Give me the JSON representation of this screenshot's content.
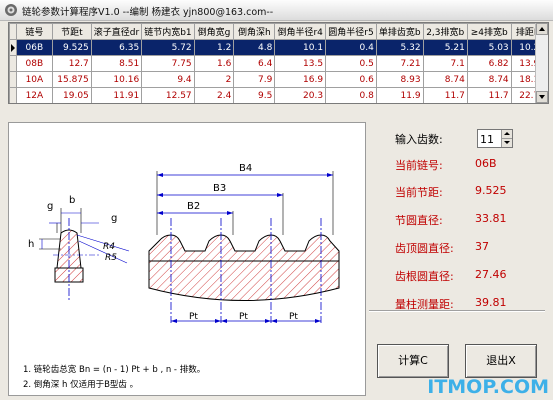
{
  "window": {
    "title": "链轮参数计算程序V1.0 --编制 杨建衣 yjn800@163.com--"
  },
  "table": {
    "headers": [
      "链号",
      "节距t",
      "滚子直径dr",
      "链节内宽b1",
      "倒角宽g",
      "倒角深h",
      "倒角半径r4",
      "圆角半径r5",
      "单排齿宽b",
      "2,3排宽b",
      "≥4排宽b",
      "排距Pt"
    ],
    "rows": [
      [
        "06B",
        "9.525",
        "6.35",
        "5.72",
        "1.2",
        "4.8",
        "10.1",
        "0.4",
        "5.32",
        "5.21",
        "5.03",
        "10.24"
      ],
      [
        "08B",
        "12.7",
        "8.51",
        "7.75",
        "1.6",
        "6.4",
        "13.5",
        "0.5",
        "7.21",
        "7.1",
        "6.82",
        "13.92"
      ],
      [
        "10A",
        "15.875",
        "10.16",
        "9.4",
        "2",
        "7.9",
        "16.9",
        "0.6",
        "8.93",
        "8.74",
        "8.74",
        "18.11"
      ],
      [
        "12A",
        "19.05",
        "11.91",
        "12.57",
        "2.4",
        "9.5",
        "20.3",
        "0.8",
        "11.9",
        "11.7",
        "11.7",
        "22.78"
      ]
    ],
    "selected_row": 0
  },
  "diagram": {
    "labels": {
      "g_top": "g",
      "b": "b",
      "g_right": "g",
      "h": "h",
      "r4": "R4",
      "r5": "R5",
      "b4": "B4",
      "b3": "B3",
      "b2": "B2",
      "pt1": "Pt",
      "pt2": "Pt",
      "pt3": "Pt"
    },
    "notes": [
      "1. 链轮齿总宽  Bn = (n - 1) Pt  + b , n - 排数。",
      "2. 倒角深 h 仅适用于B型齿 。"
    ]
  },
  "panel": {
    "teeth_label": "输入齿数:",
    "teeth_value": "11",
    "chain_label": "当前链号:",
    "chain_value": "06B",
    "pitch_label": "当前节距:",
    "pitch_value": "9.525",
    "pitch_dia_label": "节圆直径:",
    "pitch_dia_value": "33.81",
    "tip_dia_label": "齿顶圆直径:",
    "tip_dia_value": "37",
    "root_dia_label": "齿根圆直径:",
    "root_dia_value": "27.46",
    "measure_label": "量柱测量距:",
    "measure_value": "39.81",
    "calc_button": "计算C",
    "exit_button": "退出X"
  },
  "watermark": "ITMOP.COM",
  "colors": {
    "selected_row_bg": "#0a246a",
    "value_red": "#c00000",
    "drawing_blue": "#0000cc",
    "hatch_red": "#d04040",
    "watermark": "#3db0e8"
  }
}
